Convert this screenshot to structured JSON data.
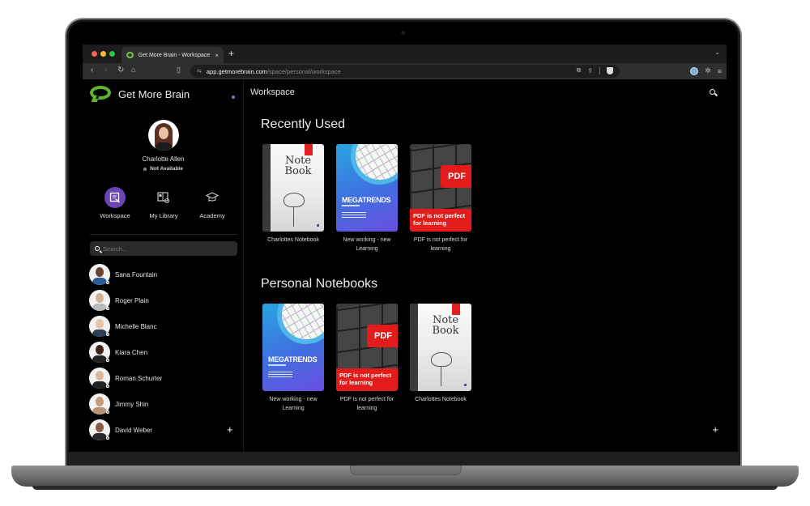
{
  "browser": {
    "tab_title": "Get More Brain - Workspace",
    "tab_close": "×",
    "new_tab": "+",
    "url_host": "app.getmorebrain.com",
    "url_path": "/space/personal/workspace",
    "icons": [
      "back-icon",
      "forward-icon",
      "reload-icon",
      "home-icon",
      "bookmark-icon",
      "site-settings-icon",
      "edit-icon",
      "share-icon",
      "brave-shield-icon",
      "profile-icon",
      "extensions-icon",
      "menu-icon"
    ]
  },
  "app": {
    "brand_name": "Get More Brain",
    "brand_color": "#5fb52e",
    "accent_color": "#6b45b8",
    "profile": {
      "name": "Charlotte Allen",
      "status": "Not Available"
    },
    "nav": [
      {
        "label": "Workspace",
        "active": true
      },
      {
        "label": "My Library",
        "active": false
      },
      {
        "label": "Academy",
        "active": false
      }
    ],
    "search": {
      "placeholder": "Search..."
    },
    "contacts": [
      {
        "name": "Sana Fountain"
      },
      {
        "name": "Roger Plain"
      },
      {
        "name": "Michelle Blanc"
      },
      {
        "name": "Kiara Chen"
      },
      {
        "name": "Roman Schurter"
      },
      {
        "name": "Jimmy Shin"
      },
      {
        "name": "David Weber"
      }
    ],
    "add_label": "+"
  },
  "main": {
    "title": "Workspace",
    "add_label": "+",
    "sections": [
      {
        "title": "Recently Used",
        "items": [
          {
            "label": "Charlottes Notebook",
            "cover": "notebook",
            "cover_text": "Note Book"
          },
          {
            "label": "New working - new Learning",
            "cover": "megatrends",
            "cover_text": "MEGATRENDS"
          },
          {
            "label": "PDF is not perfect for learning",
            "cover": "pdf",
            "cover_text": "PDF is not perfect for learning",
            "key_text": "PDF"
          }
        ]
      },
      {
        "title": "Personal Notebooks",
        "items": [
          {
            "label": "New working - new Learning",
            "cover": "megatrends",
            "cover_text": "MEGATRENDS"
          },
          {
            "label": "PDF is not perfect for learning",
            "cover": "pdf",
            "cover_text": "PDF is not perfect for learning",
            "key_text": "PDF"
          },
          {
            "label": "Charlottes Notebook",
            "cover": "notebook",
            "cover_text": "Note Book"
          }
        ]
      }
    ]
  }
}
